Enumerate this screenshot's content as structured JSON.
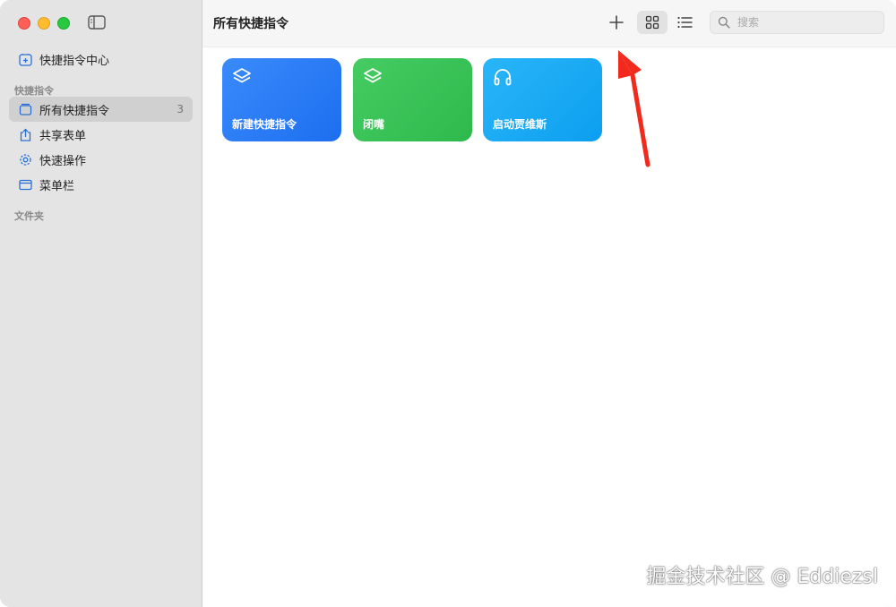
{
  "sidebar": {
    "gallery_label": "快捷指令中心",
    "section_shortcuts": "快捷指令",
    "items": [
      {
        "label": "所有快捷指令",
        "count": "3",
        "icon": "stack-icon"
      },
      {
        "label": "共享表单",
        "icon": "share-icon"
      },
      {
        "label": "快速操作",
        "icon": "gear-icon"
      },
      {
        "label": "菜单栏",
        "icon": "menubar-icon"
      }
    ],
    "section_folders": "文件夹"
  },
  "toolbar": {
    "title": "所有快捷指令",
    "search_placeholder": "搜索"
  },
  "cards": [
    {
      "title": "新建快捷指令",
      "icon": "layers-icon",
      "color": "#2a7bf6"
    },
    {
      "title": "闭嘴",
      "icon": "layers-icon",
      "color": "#34c253"
    },
    {
      "title": "启动贾维斯",
      "icon": "headphones-icon",
      "color": "#1aa8f5"
    }
  ],
  "colors": {
    "accent_blue": "#2a7bf6",
    "accent_green": "#34c253",
    "accent_cyan": "#1aa8f5",
    "annotation_arrow": "#f22a1e"
  },
  "watermark": "掘金技术社区 @ Eddiezsl"
}
